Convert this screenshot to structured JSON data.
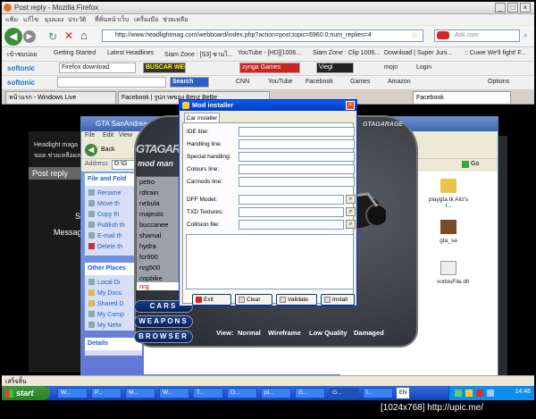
{
  "firefox": {
    "title": "Post reply - Mozilla Firefox",
    "menu": [
      "แฟ้ม",
      "แก้ไข",
      "มุมมอง",
      "ประวัติ",
      "ที่คั่นหน้าเว็บ",
      "เครื่องมือ",
      "ช่วยเหลือ"
    ],
    "url": "http://www.headlightmag.com/webboard/index.php?action=post;topic=6960.0;num_replies=4",
    "search_placeholder": "Ask.com",
    "bookmarks": [
      "เข้าชมบ่อย",
      "Getting Started",
      "Latest Headlines",
      "Siam Zone : [S3] ซามไ...",
      "YouTube - [HD][1006...",
      "Siam Zone : Clip 1006...",
      "Download | Super Juni...",
      ":: Cuwe We'll fight! F..."
    ],
    "softonic_bar": {
      "brand": "softonic",
      "field": "Firefox download",
      "buscar": "BUSCAR WEB",
      "zynga": "zynga Games",
      "viegl": "Viegl",
      "mojo": "mojo",
      "login": "Login"
    },
    "ask_bar": {
      "brand": "softonic",
      "search": "Search",
      "cnn": "CNN",
      "youtube": "YouTube",
      "facebook": "Facebook",
      "games": "Games",
      "amazon": "Amazon",
      "options": "Options"
    },
    "tabs": [
      "หน้าแรก - Windows Live",
      "Facebook | รูปภาพของ Benz BeBe",
      "Facebook"
    ]
  },
  "forum": {
    "line1": "Headlight maga",
    "line2": "ขอต.ช่วยเหลือผล",
    "post_reply": "Post reply",
    "s": "S",
    "message": "Messag"
  },
  "explorer": {
    "title": "GTA SanAndreas",
    "menu": [
      "File",
      "Edit",
      "View"
    ],
    "back": "Back",
    "address_label": "Address",
    "address_value": "D:\\G",
    "go": "Go",
    "tasks_header": "File and Fold",
    "tasks": [
      "Rename",
      "Move th",
      "Copy th",
      "Publish th",
      "E-mail th",
      "Delete th"
    ],
    "places_header": "Other Places",
    "places": [
      "Local Di",
      "My Docu",
      "Shared D",
      "My Comp",
      "My Netw"
    ],
    "details_header": "Details",
    "files": [
      {
        "name": "playgta.tk Alci's I...",
        "icon": "folder-icon"
      },
      {
        "name": "gta_sa",
        "icon": "gta-icon"
      },
      {
        "name": "vorbisFile.dll",
        "icon": "dll-icon"
      }
    ],
    "status": "เสร็จสิ้น"
  },
  "modmanager": {
    "logo": "GTAGARAGE",
    "subtitle": "mod man",
    "cars": [
      "petro",
      "rdtrain",
      "nebula",
      "majestic",
      "buccanee",
      "shamal",
      "hydra",
      "fcr900",
      "nrg500",
      "copbike"
    ],
    "selected_car": "nrg",
    "nav": [
      "CARS",
      "WEAPONS",
      "BROWSER"
    ],
    "view_label": "View:",
    "view_modes": [
      "Normal",
      "Wireframe",
      "Low Quality",
      "Damaged"
    ]
  },
  "installer": {
    "title": "Mod installer",
    "tab": "Car installer",
    "fields": [
      "IDE line:",
      "Handling line:",
      "Special handling:",
      "Colours line:",
      "Carmods line:"
    ],
    "file_fields": [
      "DFF Model:",
      "TXD Textures:",
      "Collision file:"
    ],
    "buttons": [
      "Exit",
      "Clear",
      "Validate",
      "Install"
    ]
  },
  "taskbar": {
    "start": "start",
    "items": [
      "W...",
      "P...",
      "M...",
      "W...",
      "T...",
      "O...",
      "pl...",
      "G...",
      "G...",
      "I..."
    ],
    "lang": "EN",
    "clock": "14:46"
  },
  "watermark": "[1024x768] http://upic.me/"
}
